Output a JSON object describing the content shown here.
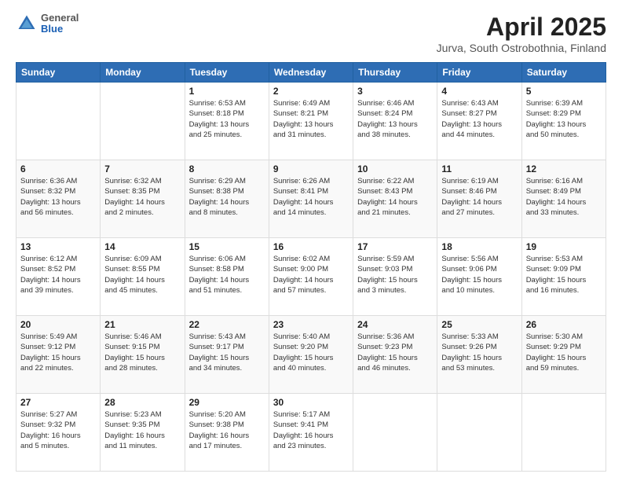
{
  "header": {
    "logo": {
      "general": "General",
      "blue": "Blue"
    },
    "title": "April 2025",
    "subtitle": "Jurva, South Ostrobothnia, Finland"
  },
  "calendar": {
    "days_of_week": [
      "Sunday",
      "Monday",
      "Tuesday",
      "Wednesday",
      "Thursday",
      "Friday",
      "Saturday"
    ],
    "weeks": [
      [
        {
          "day": "",
          "info": ""
        },
        {
          "day": "",
          "info": ""
        },
        {
          "day": "1",
          "info": "Sunrise: 6:53 AM\nSunset: 8:18 PM\nDaylight: 13 hours\nand 25 minutes."
        },
        {
          "day": "2",
          "info": "Sunrise: 6:49 AM\nSunset: 8:21 PM\nDaylight: 13 hours\nand 31 minutes."
        },
        {
          "day": "3",
          "info": "Sunrise: 6:46 AM\nSunset: 8:24 PM\nDaylight: 13 hours\nand 38 minutes."
        },
        {
          "day": "4",
          "info": "Sunrise: 6:43 AM\nSunset: 8:27 PM\nDaylight: 13 hours\nand 44 minutes."
        },
        {
          "day": "5",
          "info": "Sunrise: 6:39 AM\nSunset: 8:29 PM\nDaylight: 13 hours\nand 50 minutes."
        }
      ],
      [
        {
          "day": "6",
          "info": "Sunrise: 6:36 AM\nSunset: 8:32 PM\nDaylight: 13 hours\nand 56 minutes."
        },
        {
          "day": "7",
          "info": "Sunrise: 6:32 AM\nSunset: 8:35 PM\nDaylight: 14 hours\nand 2 minutes."
        },
        {
          "day": "8",
          "info": "Sunrise: 6:29 AM\nSunset: 8:38 PM\nDaylight: 14 hours\nand 8 minutes."
        },
        {
          "day": "9",
          "info": "Sunrise: 6:26 AM\nSunset: 8:41 PM\nDaylight: 14 hours\nand 14 minutes."
        },
        {
          "day": "10",
          "info": "Sunrise: 6:22 AM\nSunset: 8:43 PM\nDaylight: 14 hours\nand 21 minutes."
        },
        {
          "day": "11",
          "info": "Sunrise: 6:19 AM\nSunset: 8:46 PM\nDaylight: 14 hours\nand 27 minutes."
        },
        {
          "day": "12",
          "info": "Sunrise: 6:16 AM\nSunset: 8:49 PM\nDaylight: 14 hours\nand 33 minutes."
        }
      ],
      [
        {
          "day": "13",
          "info": "Sunrise: 6:12 AM\nSunset: 8:52 PM\nDaylight: 14 hours\nand 39 minutes."
        },
        {
          "day": "14",
          "info": "Sunrise: 6:09 AM\nSunset: 8:55 PM\nDaylight: 14 hours\nand 45 minutes."
        },
        {
          "day": "15",
          "info": "Sunrise: 6:06 AM\nSunset: 8:58 PM\nDaylight: 14 hours\nand 51 minutes."
        },
        {
          "day": "16",
          "info": "Sunrise: 6:02 AM\nSunset: 9:00 PM\nDaylight: 14 hours\nand 57 minutes."
        },
        {
          "day": "17",
          "info": "Sunrise: 5:59 AM\nSunset: 9:03 PM\nDaylight: 15 hours\nand 3 minutes."
        },
        {
          "day": "18",
          "info": "Sunrise: 5:56 AM\nSunset: 9:06 PM\nDaylight: 15 hours\nand 10 minutes."
        },
        {
          "day": "19",
          "info": "Sunrise: 5:53 AM\nSunset: 9:09 PM\nDaylight: 15 hours\nand 16 minutes."
        }
      ],
      [
        {
          "day": "20",
          "info": "Sunrise: 5:49 AM\nSunset: 9:12 PM\nDaylight: 15 hours\nand 22 minutes."
        },
        {
          "day": "21",
          "info": "Sunrise: 5:46 AM\nSunset: 9:15 PM\nDaylight: 15 hours\nand 28 minutes."
        },
        {
          "day": "22",
          "info": "Sunrise: 5:43 AM\nSunset: 9:17 PM\nDaylight: 15 hours\nand 34 minutes."
        },
        {
          "day": "23",
          "info": "Sunrise: 5:40 AM\nSunset: 9:20 PM\nDaylight: 15 hours\nand 40 minutes."
        },
        {
          "day": "24",
          "info": "Sunrise: 5:36 AM\nSunset: 9:23 PM\nDaylight: 15 hours\nand 46 minutes."
        },
        {
          "day": "25",
          "info": "Sunrise: 5:33 AM\nSunset: 9:26 PM\nDaylight: 15 hours\nand 53 minutes."
        },
        {
          "day": "26",
          "info": "Sunrise: 5:30 AM\nSunset: 9:29 PM\nDaylight: 15 hours\nand 59 minutes."
        }
      ],
      [
        {
          "day": "27",
          "info": "Sunrise: 5:27 AM\nSunset: 9:32 PM\nDaylight: 16 hours\nand 5 minutes."
        },
        {
          "day": "28",
          "info": "Sunrise: 5:23 AM\nSunset: 9:35 PM\nDaylight: 16 hours\nand 11 minutes."
        },
        {
          "day": "29",
          "info": "Sunrise: 5:20 AM\nSunset: 9:38 PM\nDaylight: 16 hours\nand 17 minutes."
        },
        {
          "day": "30",
          "info": "Sunrise: 5:17 AM\nSunset: 9:41 PM\nDaylight: 16 hours\nand 23 minutes."
        },
        {
          "day": "",
          "info": ""
        },
        {
          "day": "",
          "info": ""
        },
        {
          "day": "",
          "info": ""
        }
      ]
    ]
  }
}
